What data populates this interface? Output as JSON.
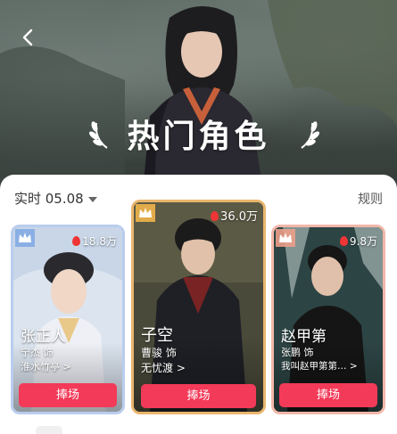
{
  "header": {
    "title": "热门角色",
    "back_icon": "chevron-left-icon",
    "laurel_icon": "laurel-icon"
  },
  "toolbar": {
    "realtime_label": "实时 05.08",
    "dropdown_icon": "caret-down-icon",
    "rules_label": "规则"
  },
  "colors": {
    "accent": "#f33a58",
    "flame": "#ef3535",
    "rank1_border": "#e9b66d",
    "rank2_border": "#b9cdee",
    "rank3_border": "#f2b7a9"
  },
  "cards": [
    {
      "rank": 2,
      "crown_icon": "crown-icon",
      "heat": "18.8万",
      "name": "张正人",
      "actor": "宁杰 饰",
      "drama": "淮水竹亭 >",
      "button": "捧场"
    },
    {
      "rank": 1,
      "crown_icon": "crown-icon",
      "heat": "36.0万",
      "name": "子空",
      "actor": "曹骏 饰",
      "drama": "无忧渡 >",
      "button": "捧场"
    },
    {
      "rank": 3,
      "crown_icon": "crown-icon",
      "heat": "9.8万",
      "name": "赵甲第",
      "actor": "张鹏 饰",
      "drama": "我叫赵甲第第… >",
      "button": "捧场"
    }
  ]
}
